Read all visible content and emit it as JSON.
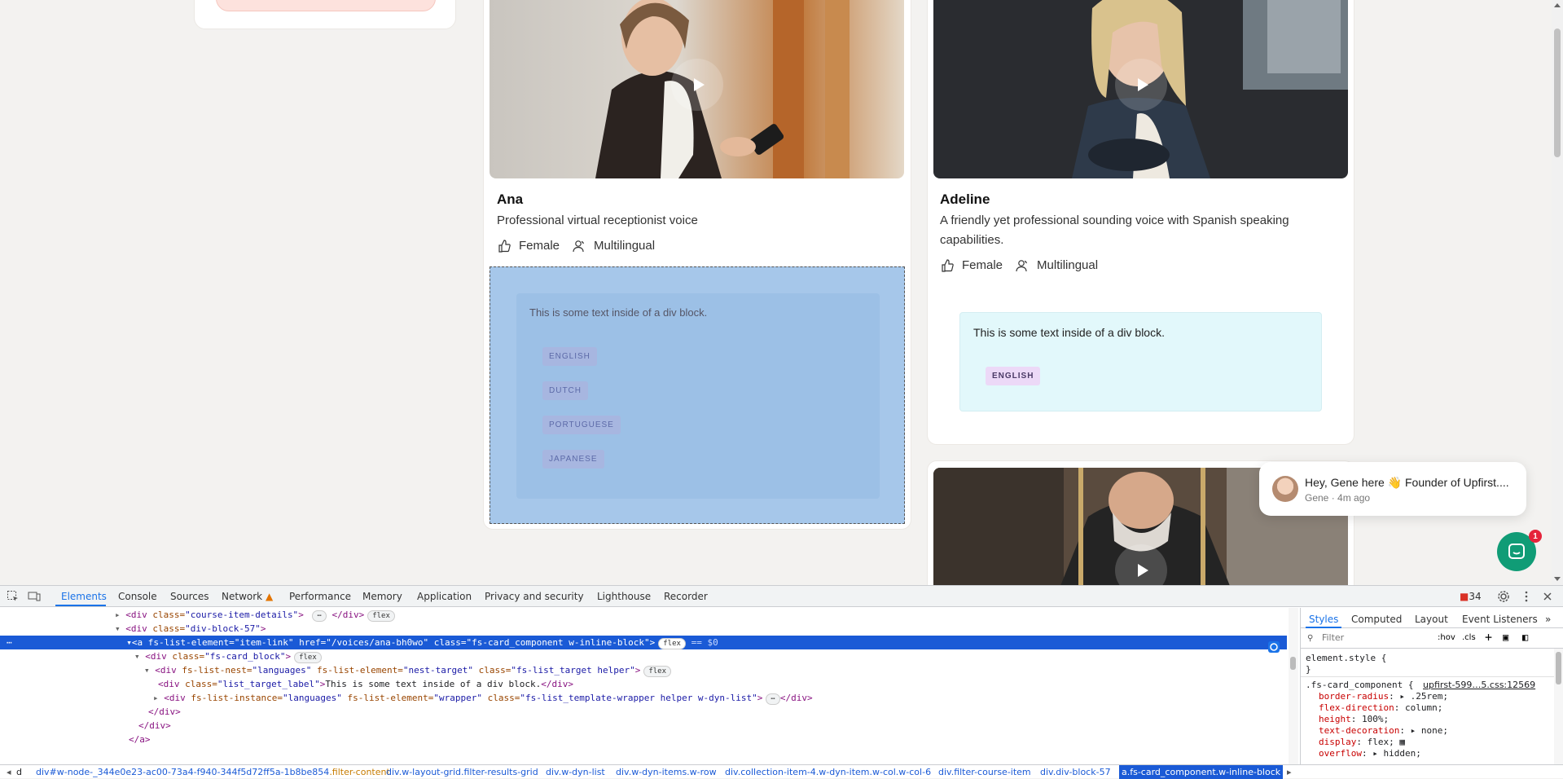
{
  "cards": [
    {
      "name": "Ana",
      "description": "Professional virtual receptionist voice",
      "gender": "Female",
      "type": "Multilingual",
      "lang_label": "This is some text inside of a div block.",
      "languages": [
        "ENGLISH",
        "DUTCH",
        "PORTUGUESE",
        "JAPANESE"
      ]
    },
    {
      "name": "Adeline",
      "description_line1": "A friendly yet professional sounding voice with Spanish speaking",
      "description_line2": "capabilities.",
      "gender": "Female",
      "type": "Multilingual",
      "lang_label": "This is some text inside of a div block.",
      "languages": [
        "ENGLISH"
      ]
    }
  ],
  "chat": {
    "title": "Hey, Gene here 👋 Founder of Upfirst....",
    "sub": "Gene · 4m ago",
    "badge": "1"
  },
  "devtools": {
    "tabs": [
      "Elements",
      "Console",
      "Sources",
      "Network",
      "Performance",
      "Memory",
      "Application",
      "Privacy and security",
      "Lighthouse",
      "Recorder"
    ],
    "issues_count": "34",
    "dom": [
      {
        "pre": "▸",
        "open": "<div",
        "attr": " class=",
        "val": "\"course-item-details\"",
        "close": "> ",
        "ellipsis": "⋯",
        "end": " </div>",
        "badge": "flex"
      },
      {
        "pre": "▾",
        "open": "<div",
        "attr": " class=",
        "val": "\"div-block-57\"",
        "close": ">"
      },
      {
        "pre": "▾",
        "selected": "<a fs-list-element=\"item-link\" href=\"/voices/ana-bh0wo\" class=\"fs-card_component w-inline-block\">",
        "badge": "flex",
        "suffix": " == $0"
      },
      {
        "pre": "▾",
        "open": "<div",
        "attr": " class=",
        "val": "\"fs-card_block\"",
        "close": ">",
        "badge": "flex"
      },
      {
        "pre": "▾",
        "open": "<div",
        "attr": " fs-list-nest=",
        "val": "\"languages\"",
        "attr2": " fs-list-element=",
        "val2": "\"nest-target\"",
        "attr3": " class=",
        "val3": "\"fs-list_target helper\"",
        "close": ">",
        "badge": "flex"
      },
      {
        "pre": "",
        "open": "<div",
        "attr": " class=",
        "val": "\"list_target_label\"",
        "close": ">",
        "text": "This is some text inside of a div block.",
        "end": "</div>"
      },
      {
        "pre": "▸",
        "open": "<div",
        "attr": " fs-list-instance=",
        "val": "\"languages\"",
        "attr2": " fs-list-element=",
        "val2": "\"wrapper\"",
        "attr3": " class=",
        "val3": "\"fs-list_template-wrapper helper w-dyn-list\"",
        "close": ">",
        "ellipsis": "⋯",
        "end": "</div>"
      },
      {
        "end": "</div>"
      },
      {
        "end": "</div>"
      },
      {
        "end": "</a>"
      }
    ],
    "styles_tabs": [
      "Styles",
      "Computed",
      "Layout",
      "Event Listeners"
    ],
    "filter_placeholder": "Filter",
    "hov": ":hov",
    "cls": ".cls",
    "element_style": "element.style {",
    "close_brace": "}",
    "rule_selector": ".fs-card_component {",
    "rule_source": "upfirst-599…5.css:12569",
    "rule_props": [
      {
        "name": "border-radius",
        "value": ".25rem;",
        "arrow": true
      },
      {
        "name": "flex-direction",
        "value": "column;"
      },
      {
        "name": "height",
        "value": "100%;"
      },
      {
        "name": "text-decoration",
        "value": "none;",
        "arrow": true
      },
      {
        "name": "display",
        "value": "flex;"
      },
      {
        "name": "overflow",
        "value": "hidden;",
        "arrow": true
      }
    ],
    "breadcrumbs": [
      {
        "tag": "d",
        "cls": ""
      },
      {
        "tag": "div#w-node-_344e0e23-ac00-73a4-f940-344f5d72ff5a-1b8be854",
        "cls": ".filter-content"
      },
      {
        "tag": "div.w-layout-grid.filter-results-grid",
        "cls": ""
      },
      {
        "tag": "div.w-dyn-list",
        "cls": ""
      },
      {
        "tag": "div.w-dyn-items.w-row",
        "cls": ""
      },
      {
        "tag": "div.collection-item-4.w-dyn-item.w-col.w-col-6",
        "cls": ""
      },
      {
        "tag": "div.filter-course-item",
        "cls": ""
      },
      {
        "tag": "div.div-block-57",
        "cls": ""
      },
      {
        "tag": "a.fs-card_component.w-inline-block",
        "cls": ""
      }
    ]
  },
  "colors": {
    "accent": "#1a73e8",
    "chat": "#109c76",
    "highlight": "#a6c7ea",
    "lang_box": "#e2f8fb"
  }
}
